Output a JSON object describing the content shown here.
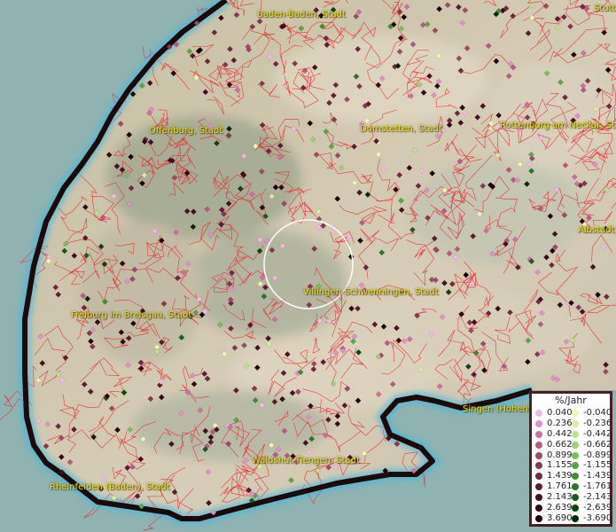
{
  "map": {
    "cities": [
      {
        "id": "baden-baden",
        "name": "Baden-Baden, Stadt"
      },
      {
        "id": "stuttgart",
        "name": "Stutt"
      },
      {
        "id": "offenburg",
        "name": "Offenburg, Stadt"
      },
      {
        "id": "dornstetten",
        "name": "Dornstetten, Stadt"
      },
      {
        "id": "rottenburg",
        "name": "Rottenburg am Neckar, Stad"
      },
      {
        "id": "albstadt",
        "name": "Albstadt,"
      },
      {
        "id": "villingen",
        "name": "Villingen-Schwenningen, Stadt"
      },
      {
        "id": "freiburg",
        "name": "Freiburg im Breisgau, Stadt"
      },
      {
        "id": "singen",
        "name": "Singen (Hohent"
      },
      {
        "id": "waldshut",
        "name": "Waldshut-Tiengen, Stadt"
      },
      {
        "id": "rheinfelden",
        "name": "Rheinfelden (Baden), Stadt"
      }
    ],
    "colors": {
      "sea": "#8fb3b0",
      "border": "#1a0a0a",
      "border_glow": "#3fb7e0",
      "admin_lines": "#e8202a",
      "label": "#e6e61e",
      "highlight_circle": "#ffffff"
    }
  },
  "legend": {
    "title": "%/Jahr",
    "positive": [
      {
        "value": "0.040",
        "color": "#f4b8e6"
      },
      {
        "value": "0.236",
        "color": "#e390c8"
      },
      {
        "value": "0.442",
        "color": "#cf6fa3"
      },
      {
        "value": "0.662",
        "color": "#b85a82"
      },
      {
        "value": "0.899",
        "color": "#a04867"
      },
      {
        "value": "1.155",
        "color": "#8a3550"
      },
      {
        "value": "1.439",
        "color": "#74263e"
      },
      {
        "value": "1.761",
        "color": "#5e1a2e"
      },
      {
        "value": "2.143",
        "color": "#480f20"
      },
      {
        "value": "2.639",
        "color": "#330714"
      },
      {
        "value": "3.690",
        "color": "#1c0209"
      }
    ],
    "negative": [
      {
        "value": "-0.040",
        "color": "#f2f6b4"
      },
      {
        "value": "-0.236",
        "color": "#d9eda0"
      },
      {
        "value": "-0.442",
        "color": "#bde289"
      },
      {
        "value": "-0.662",
        "color": "#9dd173"
      },
      {
        "value": "-0.899",
        "color": "#7bbd5c"
      },
      {
        "value": "-1.155",
        "color": "#5aa646"
      },
      {
        "value": "-1.439",
        "color": "#3f8e35"
      },
      {
        "value": "-1.761",
        "color": "#2a7527"
      },
      {
        "value": "-2.143",
        "color": "#1a5c1b"
      },
      {
        "value": "-2.639",
        "color": "#0e4210"
      },
      {
        "value": "-3.690",
        "color": "#052708"
      }
    ]
  }
}
